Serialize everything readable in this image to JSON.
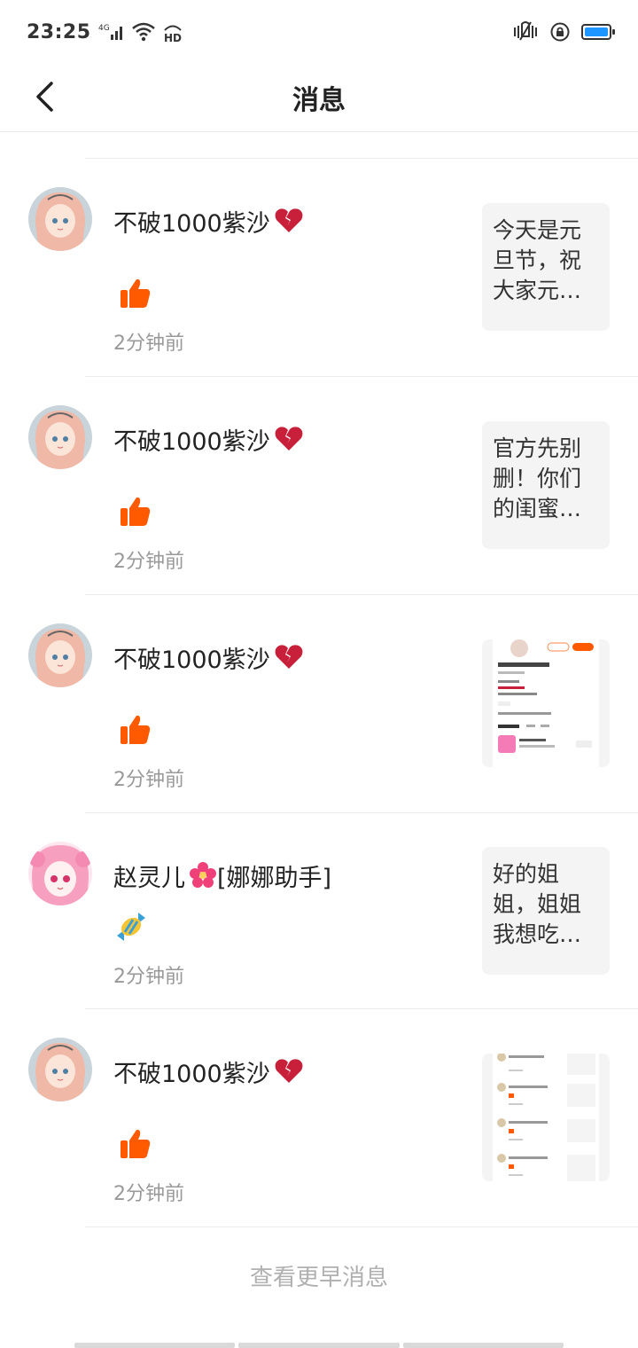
{
  "status_bar": {
    "time": "23:25",
    "network": "4G",
    "hd": "HD",
    "battery_level": 1.0,
    "battery_color": "#1e96ff"
  },
  "nav": {
    "title": "消息",
    "back_icon": "chevron-left-icon"
  },
  "accent_color": "#ff5a00",
  "messages": [
    {
      "name": "不破1000紫沙",
      "name_suffix_icon": "broken-heart-emoji",
      "action_icon": "thumbs-up-icon",
      "time": "2分钟前",
      "preview_type": "text",
      "preview_text": "今天是元旦节，祝大家元…"
    },
    {
      "name": "不破1000紫沙",
      "name_suffix_icon": "broken-heart-emoji",
      "action_icon": "thumbs-up-icon",
      "time": "2分钟前",
      "preview_type": "text",
      "preview_text": "官方先别删！你们的闺蜜…"
    },
    {
      "name": "不破1000紫沙",
      "name_suffix_icon": "broken-heart-emoji",
      "action_icon": "thumbs-up-icon",
      "time": "2分钟前",
      "preview_type": "image",
      "preview_text": ""
    },
    {
      "name": "赵灵儿",
      "name_suffix_icon": "hibiscus-emoji",
      "name_suffix_text": "[娜娜助手]",
      "action_icon": "candy-icon",
      "time": "2分钟前",
      "preview_type": "text",
      "preview_text": "好的姐姐，姐姐我想吃…"
    },
    {
      "name": "不破1000紫沙",
      "name_suffix_icon": "broken-heart-emoji",
      "action_icon": "thumbs-up-icon",
      "time": "2分钟前",
      "preview_type": "image",
      "preview_text": ""
    }
  ],
  "load_more": "查看更早消息"
}
